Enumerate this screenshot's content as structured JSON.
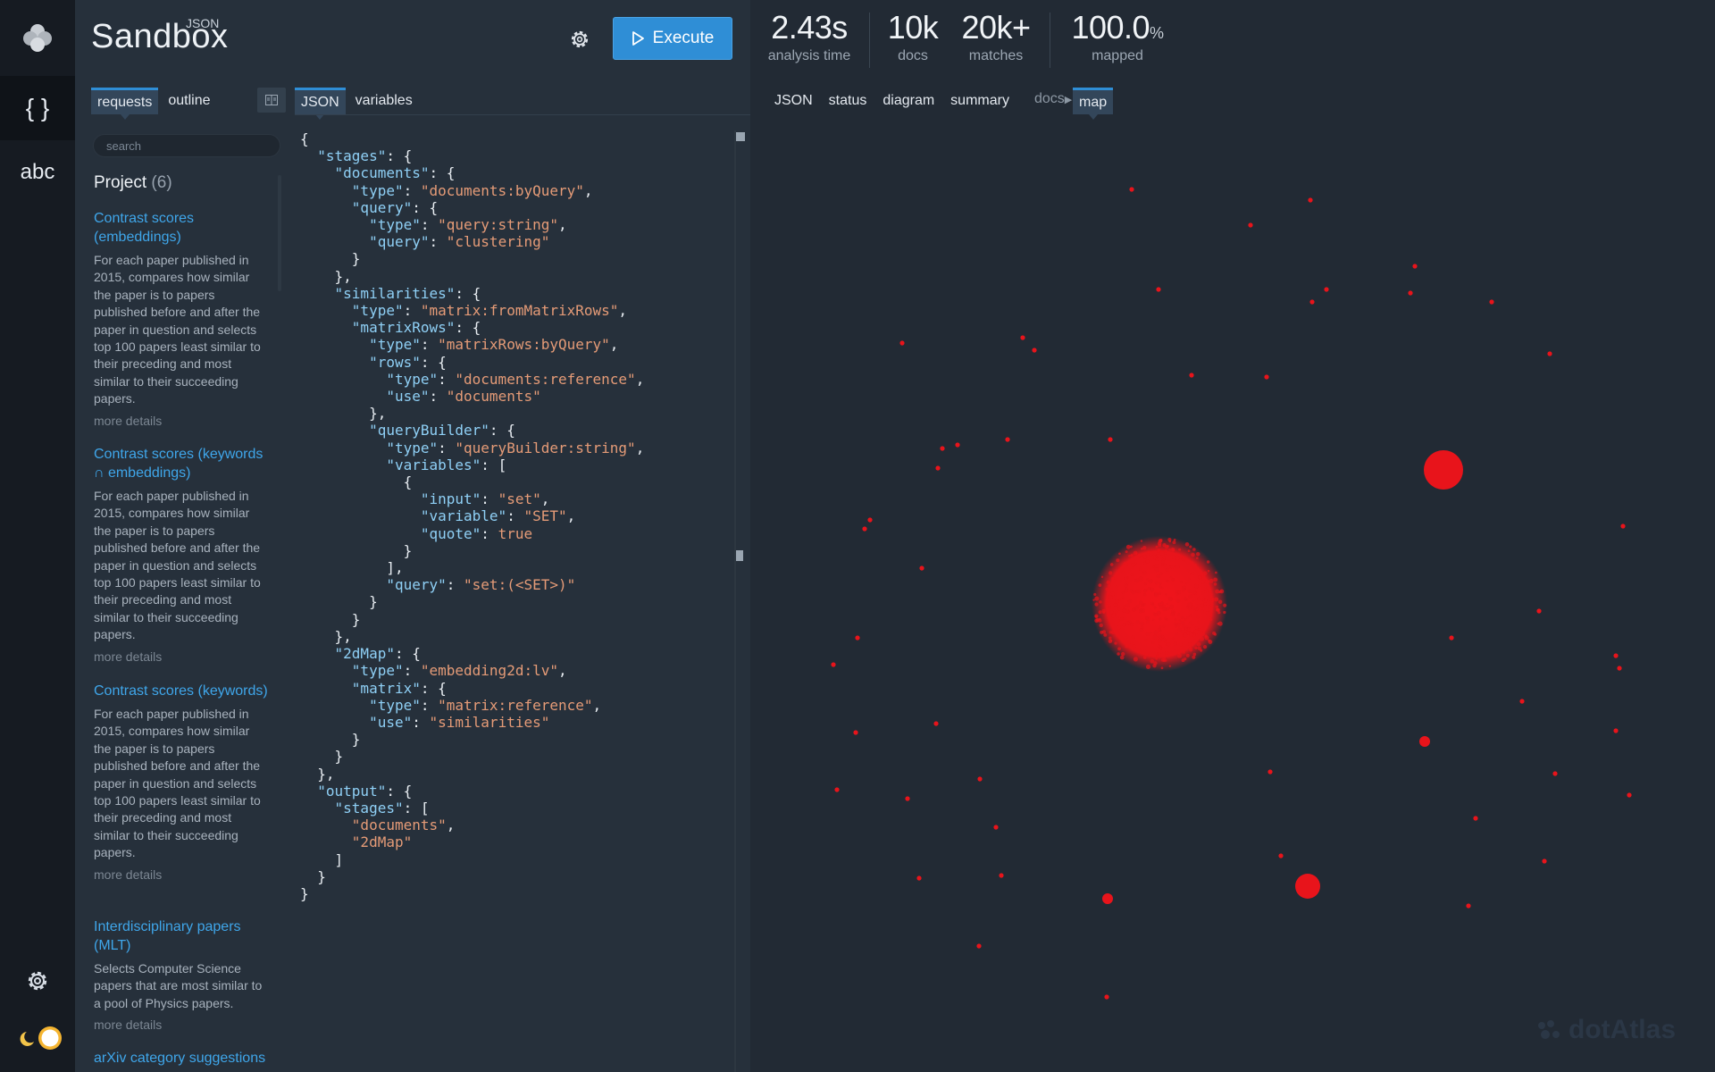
{
  "brand": {
    "sub": "JSON",
    "main": "Sandbox"
  },
  "toolbar": {
    "execute_label": "Execute"
  },
  "stats": [
    {
      "value": "2.43",
      "unit": "s",
      "label": "analysis time"
    },
    {
      "value": "10k",
      "unit": "",
      "label": "docs"
    },
    {
      "value": "20k+",
      "unit": "",
      "label": "matches"
    },
    {
      "value": "100.0",
      "unit": "%",
      "label": "mapped"
    }
  ],
  "left_tabs": {
    "requests": "requests",
    "outline": "outline"
  },
  "editor_tabs": {
    "json": "JSON",
    "variables": "variables"
  },
  "right_tabs": {
    "json": "JSON",
    "status": "status",
    "diagram": "diagram",
    "summary": "summary",
    "docs": "docs",
    "map": "map"
  },
  "rail": {
    "json_tool": "{ }",
    "text_tool": "abc"
  },
  "search": {
    "placeholder": "search"
  },
  "project": {
    "title": "Project",
    "count": "(6)"
  },
  "requests": [
    {
      "title": "Contrast scores (embeddings)",
      "desc": "For each paper published in 2015, compares how similar the paper is to papers published before and after the paper in question and selects top 100 papers least similar to their preceding and most similar to their succeeding papers.",
      "more": "more details"
    },
    {
      "title": "Contrast scores (keywords ∩ embeddings)",
      "desc": "For each paper published in 2015, compares how similar the paper is to papers published before and after the paper in question and selects top 100 papers least similar to their preceding and most similar to their succeeding papers.",
      "more": "more details"
    },
    {
      "title": "Contrast scores (keywords)",
      "desc": "For each paper published in 2015, compares how similar the paper is to papers published before and after the paper in question and selects top 100 papers least similar to their preceding and most similar to their succeeding papers.",
      "more": "more details"
    },
    {
      "title": "Interdisciplinary papers (MLT)",
      "desc": "Selects Computer Science papers that are most similar to a pool of Physics papers.",
      "more": "more details"
    },
    {
      "title": "arXiv category suggestions",
      "desc": "",
      "more": ""
    }
  ],
  "code": "{\n  \"stages\": {\n    \"documents\": {\n      \"type\": \"documents:byQuery\",\n      \"query\": {\n        \"type\": \"query:string\",\n        \"query\": \"clustering\"\n      }\n    },\n    \"similarities\": {\n      \"type\": \"matrix:fromMatrixRows\",\n      \"matrixRows\": {\n        \"type\": \"matrixRows:byQuery\",\n        \"rows\": {\n          \"type\": \"documents:reference\",\n          \"use\": \"documents\"\n        },\n        \"queryBuilder\": {\n          \"type\": \"queryBuilder:string\",\n          \"variables\": [\n            {\n              \"input\": \"set\",\n              \"variable\": \"SET\",\n              \"quote\": true\n            }\n          ],\n          \"query\": \"set:(<SET>)\"\n        }\n      }\n    },\n    \"2dMap\": {\n      \"type\": \"embedding2d:lv\",\n      \"matrix\": {\n        \"type\": \"matrix:reference\",\n        \"use\": \"similarities\"\n      }\n    }\n  },\n  \"output\": {\n    \"stages\": [\n      \"documents\",\n      \"2dMap\"\n    ]\n  }\n}",
  "watermark": "dotAtlas",
  "colors": {
    "accent": "#2f8ed6",
    "link": "#3fa6ea",
    "dot": "#e8141b"
  }
}
